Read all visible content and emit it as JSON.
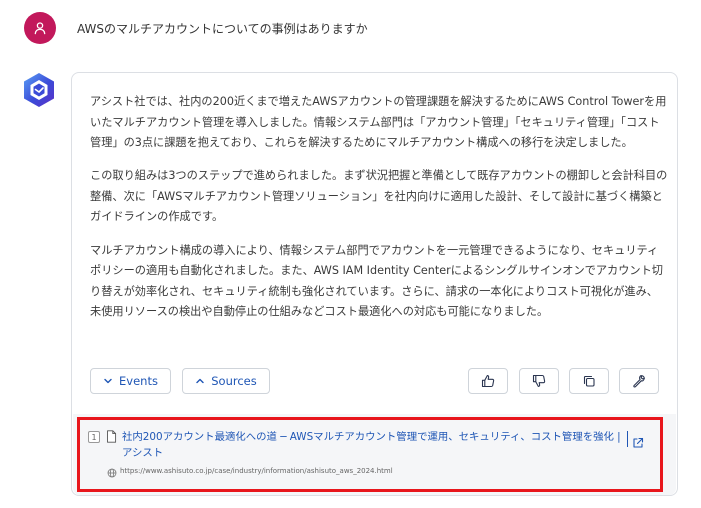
{
  "conversation": {
    "user_message": "AWSのマルチアカウントについての事例はありますか",
    "answer_paragraphs": [
      "アシスト社では、社内の200近くまで増えたAWSアカウントの管理課題を解決するためにAWS Control Towerを用いたマルチアカウント管理を導入しました。情報システム部門は「アカウント管理」「セキュリティ管理」「コスト管理」の3点に課題を抱えており、これらを解決するためにマルチアカウント構成への移行を決定しました。",
      "この取り組みは3つのステップで進められました。まず状況把握と準備として既存アカウントの棚卸しと会計科目の整備、次に「AWSマルチアカウント管理ソリューション」を社内向けに適用した設計、そして設計に基づく構築とガイドラインの作成です。",
      "マルチアカウント構成の導入により、情報システム部門でアカウントを一元管理できるようになり、セキュリティポリシーの適用も自動化されました。また、AWS IAM Identity Centerによるシングルサインオンでアカウント切り替えが効率化され、セキュリティ統制も強化されています。さらに、請求の一本化によりコスト可視化が進み、未使用リソースの検出や自動停止の仕組みなどコスト最適化への対応も可能になりました。"
    ]
  },
  "actions": {
    "events_label": "Events",
    "sources_label": "Sources"
  },
  "sources": [
    {
      "index": "1",
      "title": "社内200アカウント最適化への道 ─ AWSマルチアカウント管理で運用、セキュリティ、コスト管理を強化 | アシスト",
      "url": "https://www.ashisuto.co.jp/case/industry/information/ashisuto_aws_2024.html"
    }
  ],
  "colors": {
    "user_avatar": "#c2185b",
    "bot_avatar": "#3b4bd8",
    "link": "#1f56b5",
    "highlight_border": "#e8161c"
  },
  "icons": {
    "user": "person-icon",
    "bot": "hexagon-logo-icon",
    "events": "chevron-down-icon",
    "sources": "chevron-up-icon",
    "like": "thumbs-up-icon",
    "dislike": "thumbs-down-icon",
    "copy": "copy-icon",
    "tool": "wrench-icon",
    "document": "document-icon",
    "external": "external-link-icon",
    "globe": "globe-icon"
  }
}
